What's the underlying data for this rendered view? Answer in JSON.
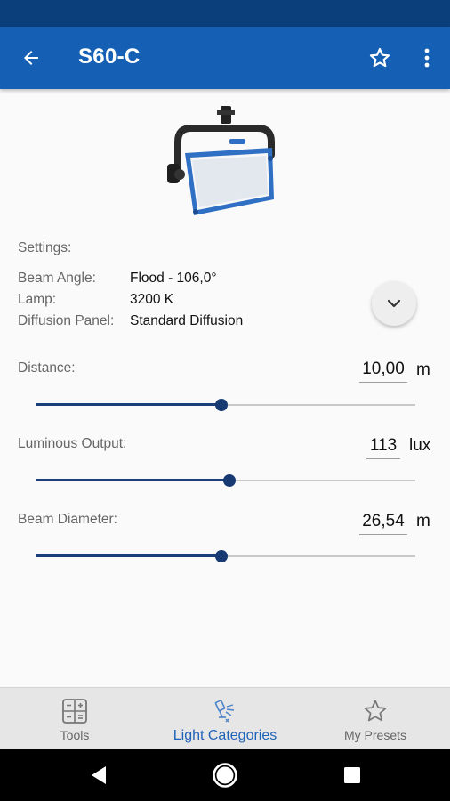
{
  "app_bar": {
    "title": "S60-C",
    "icons": [
      "back-arrow-icon",
      "star-outline-icon",
      "more-vertical-icon"
    ]
  },
  "product": {
    "image": "softlight-panel-fixture"
  },
  "settings": {
    "heading": "Settings:",
    "rows": [
      {
        "label": "Beam Angle:",
        "value": "Flood - 106,0°"
      },
      {
        "label": "Lamp:",
        "value": "3200 K"
      },
      {
        "label": "Diffusion Panel:",
        "value": "Standard Diffusion"
      }
    ],
    "expand_icon": "chevron-down-icon"
  },
  "params": [
    {
      "label": "Distance:",
      "value": "10,00",
      "unit": "m",
      "slider_level": 0.49
    },
    {
      "label": "Luminous Output:",
      "value": "113",
      "unit": "lux",
      "slider_level": 0.51
    },
    {
      "label": "Beam Diameter:",
      "value": "26,54",
      "unit": "m",
      "slider_level": 0.49
    }
  ],
  "bottom_nav": {
    "items": [
      {
        "label": "Tools",
        "icon": "calculator-icon",
        "active": false
      },
      {
        "label": "Light Categories",
        "icon": "spotlight-icon",
        "active": true
      },
      {
        "label": "My Presets",
        "icon": "star-outline-icon",
        "active": false
      }
    ]
  },
  "colors": {
    "status_bar": "#0b3f7c",
    "app_bar": "#1560b4",
    "accent": "#1f63b8",
    "slider": "#1a3f7a"
  }
}
